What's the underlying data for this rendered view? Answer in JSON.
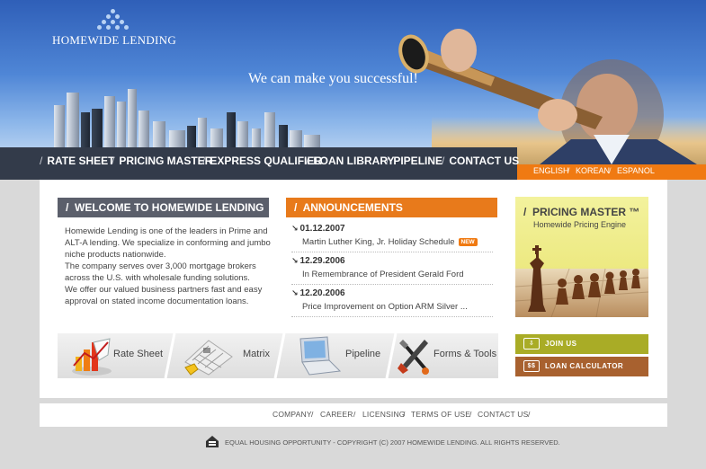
{
  "brand": {
    "name": "HOMEWIDE LENDING",
    "tagline": "We can make you successful!"
  },
  "nav": {
    "items": [
      {
        "label": "RATE SHEET"
      },
      {
        "label": "PRICING MASTER"
      },
      {
        "label": "EXPRESS QUALIFIER"
      },
      {
        "label": "LOAN LIBRARY"
      },
      {
        "label": "PIPELINE"
      },
      {
        "label": "CONTACT US"
      }
    ]
  },
  "languages": [
    "ENGLISH",
    "KOREAN",
    "ESPANOL"
  ],
  "welcome": {
    "heading": "WELCOME TO HOMEWIDE LENDING",
    "paragraphs": [
      "Homewide Lending is one of the leaders in Prime and ALT-A lending. We specialize in conforming and jumbo niche products nationwide.",
      "The company serves over 3,000 mortgage brokers across the U.S. with wholesale funding solutions.",
      "We offer our valued business partners fast and easy approval on stated income documentation loans."
    ]
  },
  "announcements": {
    "heading": "ANNOUNCEMENTS",
    "badge": "NEW",
    "items": [
      {
        "date": "01.12.2007",
        "title": "Martin Luther King, Jr. Holiday Schedule"
      },
      {
        "date": "12.29.2006",
        "title": "In Remembrance of President Gerald Ford"
      },
      {
        "date": "12.20.2006",
        "title": "Price Improvement on Option ARM Silver ..."
      }
    ]
  },
  "quick_links": [
    {
      "label": "Rate Sheet",
      "icon": "chart-icon"
    },
    {
      "label": "Matrix",
      "icon": "puzzle-icon"
    },
    {
      "label": "Pipeline",
      "icon": "laptop-icon"
    },
    {
      "label": "Forms & Tools",
      "icon": "tools-icon"
    }
  ],
  "promo": {
    "title": "PRICING MASTER ™",
    "subtitle": "Homewide Pricing Engine"
  },
  "side_buttons": {
    "join": {
      "label": "JOIN US",
      "icon": "download-icon"
    },
    "calc": {
      "label": "LOAN CALCULATOR",
      "icon_text": "$$"
    }
  },
  "footer": {
    "links": [
      "COMPANY",
      "CAREER",
      "LICENSING",
      "TERMS OF USE",
      "CONTACT US"
    ],
    "copyright": "EQUAL HOUSING OPPORTUNITY -   COPYRIGHT (C) 2007 HOMEWIDE LENDING. ALL RIGHTS RESERVED."
  },
  "colors": {
    "nav_bg": "#333b4a",
    "accent_orange": "#f07a12",
    "welcome_head": "#5b5f6b",
    "join_btn": "#a9ac26",
    "calc_btn": "#a8612f",
    "promo_bg": "#f3f29d"
  }
}
